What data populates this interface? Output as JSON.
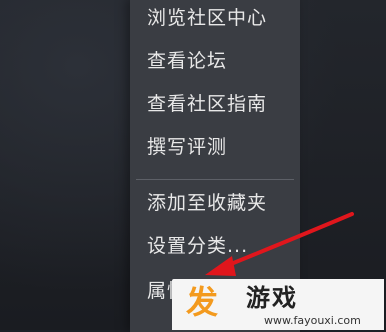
{
  "context_menu": {
    "items": [
      {
        "label": "浏览社区中心"
      },
      {
        "label": "查看论坛"
      },
      {
        "label": "查看社区指南"
      },
      {
        "label": "撰写评测"
      },
      {
        "label": "添加至收藏夹"
      },
      {
        "label": "设置分类..."
      },
      {
        "label": "属性"
      }
    ]
  },
  "watermark": {
    "title": "游戏",
    "url": "www.fayouxi.com",
    "logo_text": "发",
    "accent_color": "#f39a1e"
  },
  "annotation": {
    "arrow_color": "#e0161c"
  }
}
